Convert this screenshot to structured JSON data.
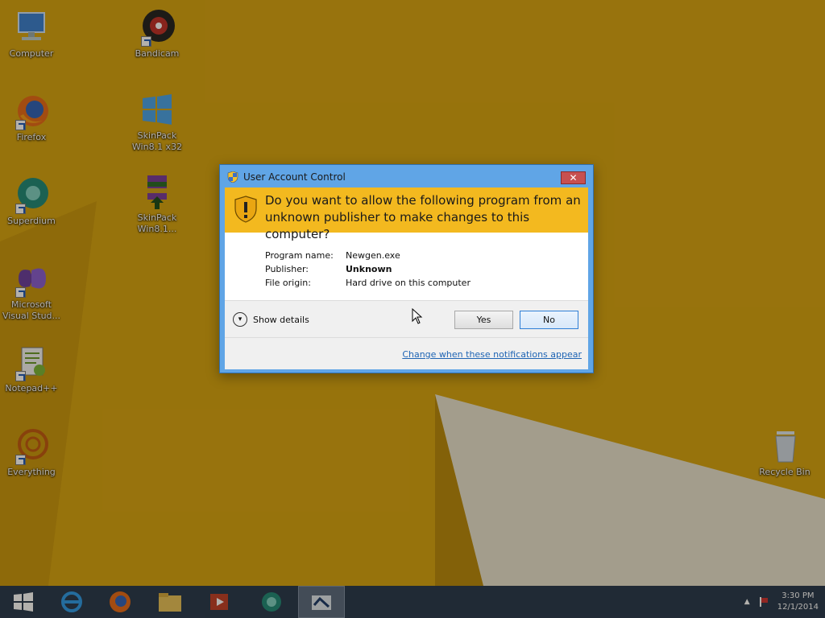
{
  "desktop": {
    "icons": [
      {
        "label": "Computer",
        "icon": "computer-icon"
      },
      {
        "label": "Bandicam",
        "icon": "bandicam-icon"
      },
      {
        "label": "Firefox",
        "icon": "firefox-icon"
      },
      {
        "label": "SkinPack Win8.1 x32",
        "icon": "skinpack-icon"
      },
      {
        "label": "Superdium",
        "icon": "superdium-icon"
      },
      {
        "label": "SkinPack Win8.1...",
        "icon": "winrar-icon"
      },
      {
        "label": "Microsoft Visual Stud...",
        "icon": "visual-studio-icon"
      },
      {
        "label": "Notepad++",
        "icon": "notepadpp-icon"
      },
      {
        "label": "Everything",
        "icon": "everything-icon"
      },
      {
        "label": "Recycle Bin",
        "icon": "recycle-bin-icon"
      }
    ]
  },
  "dialog": {
    "title": "User Account Control",
    "close_label": "✕",
    "question": "Do you want to allow the following program from an unknown publisher to make changes to this computer?",
    "program_name_label": "Program name:",
    "program_name_value": "Newgen.exe",
    "publisher_label": "Publisher:",
    "publisher_value": "Unknown",
    "file_origin_label": "File origin:",
    "file_origin_value": "Hard drive on this computer",
    "show_details_label": "Show details",
    "yes_label": "Yes",
    "no_label": "No",
    "link_label": "Change when these notifications appear"
  },
  "taskbar": {
    "buttons": [
      "start-button",
      "internet-explorer",
      "firefox",
      "file-explorer",
      "media-player",
      "superdium",
      "newgen-active"
    ],
    "clock_time": "3:30 PM",
    "clock_date": "12/1/2014"
  },
  "colors": {
    "wallpaper": "#d4a312",
    "banner": "#f3b91f",
    "dialog_frame": "#60a5e6",
    "taskbar": "#27384f",
    "link": "#1e64b4"
  }
}
